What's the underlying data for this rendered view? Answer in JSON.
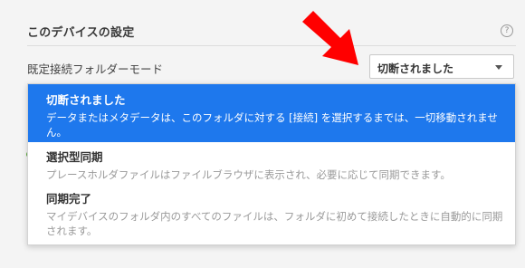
{
  "section": {
    "title": "このデバイスの設定",
    "help_icon": "?"
  },
  "setting": {
    "label": "既定接続フォルダーモード",
    "selected_value": "切断されました"
  },
  "annotation": {
    "arrow_color": "#ff0000"
  },
  "colors": {
    "selected_option_bg": "#1e78ed",
    "status_dot": "#5aaa3a"
  },
  "options": [
    {
      "title": "切断されました",
      "description": "データまたはメタデータは、このフォルダに対する [接続] を選択するまでは、一切移動されません。",
      "selected": true
    },
    {
      "title": "選択型同期",
      "description": "プレースホルダファイルはファイルブラウザに表示され、必要に応じて同期できます。",
      "selected": false
    },
    {
      "title": "同期完了",
      "description": "マイデバイスのフォルダ内のすべてのファイルは、フォルダに初めて接続したときに自動的に同期されます。",
      "selected": false
    }
  ]
}
